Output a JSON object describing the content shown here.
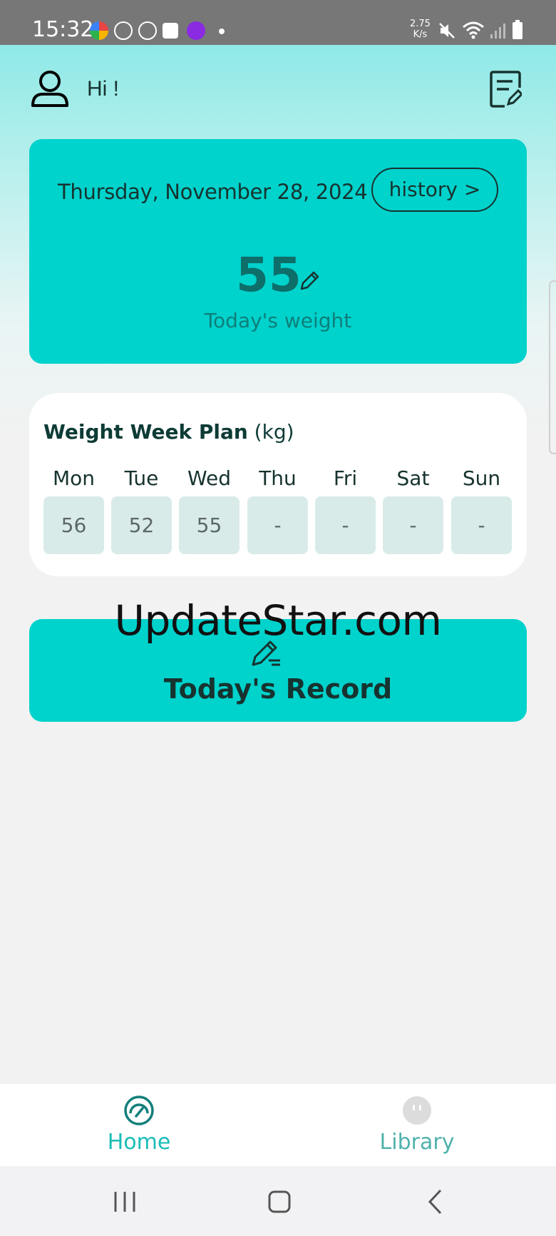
{
  "status_bar": {
    "time": "15:32",
    "net_speed_value": "2.75",
    "net_speed_unit": "K/s",
    "icons": [
      "app-colorful-icon",
      "app-grid-icon",
      "app-compass-icon",
      "app-check-icon",
      "app-play-icon",
      "dot-icon",
      "mute-icon",
      "wifi-icon",
      "signal-icon",
      "battery-icon"
    ]
  },
  "header": {
    "greeting": "Hi !",
    "avatar_icon": "user-icon",
    "action_icon": "edit-document-icon"
  },
  "weight_card": {
    "date": "Thursday, November 28, 2024",
    "history_label": "history >",
    "weight_value": "55",
    "weight_label": "Today's weight"
  },
  "plan": {
    "title_bold": "Weight Week Plan",
    "title_unit": " (kg)",
    "days": [
      {
        "name": "Mon",
        "value": "56"
      },
      {
        "name": "Tue",
        "value": "52"
      },
      {
        "name": "Wed",
        "value": "55"
      },
      {
        "name": "Thu",
        "value": "-"
      },
      {
        "name": "Fri",
        "value": "-"
      },
      {
        "name": "Sat",
        "value": "-"
      },
      {
        "name": "Sun",
        "value": "-"
      }
    ]
  },
  "record_button": {
    "label": "Today's Record",
    "icon": "edit-pen-icon"
  },
  "watermark": "UpdateStar.com",
  "bottom_nav": {
    "items": [
      {
        "label": "Home",
        "icon": "gauge-icon",
        "active": true
      },
      {
        "label": "Library",
        "icon": "face-icon",
        "active": false
      }
    ]
  },
  "colors": {
    "accent": "#00d2cc",
    "dark_text": "#17332f",
    "active_nav": "#19bdb6",
    "inactive_nav": "#4fb2ab"
  }
}
